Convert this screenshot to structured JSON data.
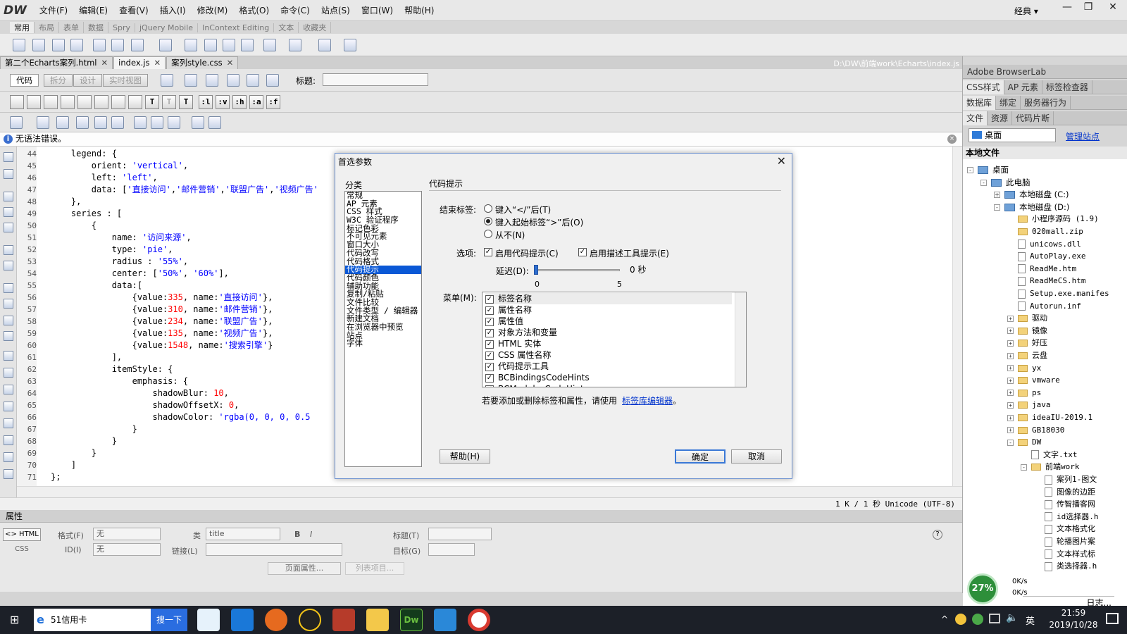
{
  "app": {
    "logo": "DW",
    "menus": [
      "文件(F)",
      "编辑(E)",
      "查看(V)",
      "插入(I)",
      "修改(M)",
      "格式(O)",
      "命令(C)",
      "站点(S)",
      "窗口(W)",
      "帮助(H)"
    ],
    "workspace": "经典 ▾",
    "window_controls": [
      "—",
      "❐",
      "✕"
    ]
  },
  "insert_tabs": [
    "常用",
    "布局",
    "表单",
    "数据",
    "Spry",
    "jQuery Mobile",
    "InContext Editing",
    "文本",
    "收藏夹"
  ],
  "doc_tabs": [
    {
      "label": "第二个Echarts案列.html",
      "close": "✕"
    },
    {
      "label": "index.js",
      "close": "✕"
    },
    {
      "label": "案列style.css",
      "close": "✕"
    }
  ],
  "doc_path": "D:\\DW\\前端work\\Echarts\\index.js",
  "view_buttons": [
    "代码",
    "拆分",
    "设计",
    "实时视图"
  ],
  "title_label": "标题:",
  "coding_buttons": [
    ":l",
    ":v",
    ":h",
    ":a",
    ":f"
  ],
  "error_bar": {
    "text": "无语法错误。",
    "icon": "i",
    "close": "×"
  },
  "code_lines": [
    {
      "n": "44",
      "html": "    legend: {"
    },
    {
      "n": "45",
      "html": "        orient: <span class='str'>'vertical'</span>,"
    },
    {
      "n": "46",
      "html": "        left: <span class='str'>'left'</span>,"
    },
    {
      "n": "47",
      "html": "        data: [<span class='str'>'直接访问'</span>,<span class='str'>'邮件营销'</span>,<span class='str'>'联盟广告'</span>,<span class='str'>'视频广告'</span>"
    },
    {
      "n": "48",
      "html": "    },"
    },
    {
      "n": "49",
      "html": "    series : ["
    },
    {
      "n": "50",
      "html": "        {"
    },
    {
      "n": "51",
      "html": "            name: <span class='str'>'访问来源'</span>,"
    },
    {
      "n": "52",
      "html": "            type: <span class='str'>'pie'</span>,"
    },
    {
      "n": "53",
      "html": "            radius : <span class='str'>'55%'</span>,"
    },
    {
      "n": "54",
      "html": "            center: [<span class='str'>'50%'</span>, <span class='str'>'60%'</span>],"
    },
    {
      "n": "55",
      "html": "            data:["
    },
    {
      "n": "56",
      "html": "                {value:<span class='num'>335</span>, name:<span class='str'>'直接访问'</span>},"
    },
    {
      "n": "57",
      "html": "                {value:<span class='num'>310</span>, name:<span class='str'>'邮件营销'</span>},"
    },
    {
      "n": "58",
      "html": "                {value:<span class='num'>234</span>, name:<span class='str'>'联盟广告'</span>},"
    },
    {
      "n": "59",
      "html": "                {value:<span class='num'>135</span>, name:<span class='str'>'视频广告'</span>},"
    },
    {
      "n": "60",
      "html": "                {value:<span class='num'>1548</span>, name:<span class='str'>'搜索引擎'</span>}"
    },
    {
      "n": "61",
      "html": "            ],"
    },
    {
      "n": "62",
      "html": "            itemStyle: {"
    },
    {
      "n": "63",
      "html": "                emphasis: {"
    },
    {
      "n": "64",
      "html": "                    shadowBlur: <span class='num'>10</span>,"
    },
    {
      "n": "65",
      "html": "                    shadowOffsetX: <span class='num'>0</span>,"
    },
    {
      "n": "66",
      "html": "                    shadowColor: <span class='str'>'rgba(0, 0, 0, 0.5</span>"
    },
    {
      "n": "67",
      "html": "                }"
    },
    {
      "n": "68",
      "html": "            }"
    },
    {
      "n": "69",
      "html": "        }"
    },
    {
      "n": "70",
      "html": "    ]"
    },
    {
      "n": "71",
      "html": "};"
    },
    {
      "n": "72",
      "html": ""
    }
  ],
  "status_bar": "1 K / 1 秒  Unicode (UTF-8)",
  "properties": {
    "title": "属性",
    "html_btn": "<> HTML",
    "css_btn": "CSS",
    "format_label": "格式(F)",
    "format_value": "无",
    "id_label": "ID(I)",
    "id_value": "无",
    "class_label": "类",
    "class_value": "title",
    "link_label": "链接(L)",
    "title_label": "标题(T)",
    "target_label": "目标(G)",
    "page_props": "页面属性...",
    "list_item": "列表项目..."
  },
  "right_panel": {
    "browserlab": "Adobe BrowserLab",
    "row2": [
      "CSS样式",
      "AP 元素",
      "标签检查器"
    ],
    "row3": [
      "数据库",
      "绑定",
      "服务器行为"
    ],
    "row4": [
      "文件",
      "资源",
      "代码片断"
    ],
    "site_select": "桌面",
    "manage_site": "管理站点",
    "local_files": "本地文件",
    "tree": [
      {
        "label": "桌面",
        "depth": 0,
        "icon": "desktop",
        "pm": "-"
      },
      {
        "label": "此电脑",
        "depth": 1,
        "icon": "desktop",
        "pm": "-"
      },
      {
        "label": "本地磁盘 (C:)",
        "depth": 2,
        "icon": "drive",
        "pm": "+"
      },
      {
        "label": "本地磁盘 (D:)",
        "depth": 2,
        "icon": "drive",
        "pm": "-"
      },
      {
        "label": "小程序源码 (1.9)",
        "depth": 3,
        "icon": "folder",
        "pm": ""
      },
      {
        "label": "020mall.zip",
        "depth": 3,
        "icon": "folder",
        "pm": ""
      },
      {
        "label": "unicows.dll",
        "depth": 3,
        "icon": "file",
        "pm": ""
      },
      {
        "label": "AutoPlay.exe",
        "depth": 3,
        "icon": "file",
        "pm": ""
      },
      {
        "label": "ReadMe.htm",
        "depth": 3,
        "icon": "file",
        "pm": ""
      },
      {
        "label": "ReadMeCS.htm",
        "depth": 3,
        "icon": "file",
        "pm": ""
      },
      {
        "label": "Setup.exe.manifes",
        "depth": 3,
        "icon": "file",
        "pm": ""
      },
      {
        "label": "Autorun.inf",
        "depth": 3,
        "icon": "file",
        "pm": ""
      },
      {
        "label": "驱动",
        "depth": 3,
        "icon": "folder",
        "pm": "+"
      },
      {
        "label": "镜像",
        "depth": 3,
        "icon": "folder",
        "pm": "+"
      },
      {
        "label": "好压",
        "depth": 3,
        "icon": "folder",
        "pm": "+"
      },
      {
        "label": "云盘",
        "depth": 3,
        "icon": "folder",
        "pm": "+"
      },
      {
        "label": "yx",
        "depth": 3,
        "icon": "folder",
        "pm": "+"
      },
      {
        "label": "vmware",
        "depth": 3,
        "icon": "folder",
        "pm": "+"
      },
      {
        "label": "ps",
        "depth": 3,
        "icon": "folder",
        "pm": "+"
      },
      {
        "label": "java",
        "depth": 3,
        "icon": "folder",
        "pm": "+"
      },
      {
        "label": "ideaIU-2019.1",
        "depth": 3,
        "icon": "folder",
        "pm": "+"
      },
      {
        "label": "GB18030",
        "depth": 3,
        "icon": "folder",
        "pm": "+"
      },
      {
        "label": "DW",
        "depth": 3,
        "icon": "folder",
        "pm": "-"
      },
      {
        "label": "文字.txt",
        "depth": 4,
        "icon": "file",
        "pm": ""
      },
      {
        "label": "前端work",
        "depth": 4,
        "icon": "folder",
        "pm": "-"
      },
      {
        "label": "案列1-图文",
        "depth": 5,
        "icon": "file",
        "pm": ""
      },
      {
        "label": "图像的边距",
        "depth": 5,
        "icon": "file",
        "pm": ""
      },
      {
        "label": "传智播客网",
        "depth": 5,
        "icon": "file",
        "pm": ""
      },
      {
        "label": "id选择器.h",
        "depth": 5,
        "icon": "file",
        "pm": ""
      },
      {
        "label": "文本格式化",
        "depth": 5,
        "icon": "file",
        "pm": ""
      },
      {
        "label": "轮播图片案",
        "depth": 5,
        "icon": "file",
        "pm": ""
      },
      {
        "label": "文本样式标",
        "depth": 5,
        "icon": "file",
        "pm": ""
      },
      {
        "label": "类选择器.h",
        "depth": 5,
        "icon": "file",
        "pm": ""
      }
    ],
    "net_percent": "27%",
    "net_up": "0K/s",
    "net_down": "0K/s",
    "log_btn": "日志..."
  },
  "dialog": {
    "title": "首选参数",
    "close": "✕",
    "category_label": "分类",
    "categories": [
      "常规",
      "AP 元素",
      "CSS 样式",
      "W3C 验证程序",
      "标记色彩",
      "不可见元素",
      "窗口大小",
      "代码改写",
      "代码格式",
      "代码提示",
      "代码颜色",
      "辅助功能",
      "复制/粘贴",
      "文件比较",
      "文件类型 / 编辑器",
      "新建文档",
      "在浏览器中预览",
      "站点",
      "字体"
    ],
    "selected_category": "代码提示",
    "section_title": "代码提示",
    "close_tag_label": "结束标签:",
    "radio_options": [
      "键入“</”后(T)",
      "键入起始标签“>”后(O)",
      "从不(N)"
    ],
    "selected_radio": 1,
    "options_label": "选项:",
    "opt_codehints": "启用代码提示(C)",
    "opt_tooltips": "启用描述工具提示(E)",
    "delay_label": "延迟(D):",
    "delay_value": "0 秒",
    "slider_value": 0,
    "slider_min": "0",
    "slider_max": "5",
    "menu_label": "菜单(M):",
    "menu_items": [
      "标签名称",
      "属性名称",
      "属性值",
      "对象方法和变量",
      "HTML 实体",
      "CSS 属性名称",
      "代码提示工具",
      "BCBindingsCodeHints",
      "BCModulesCodeHints"
    ],
    "hint_text": "若要添加或删除标签和属性，请使用",
    "hint_link": "标签库编辑器",
    "hint_end": "。",
    "help_btn": "帮助(H)",
    "ok_btn": "确定",
    "cancel_btn": "取消"
  },
  "taskbar": {
    "search_text": "51信用卡",
    "search_btn": "搜一下",
    "ime": "英",
    "time": "21:59",
    "date": "2019/10/28"
  }
}
